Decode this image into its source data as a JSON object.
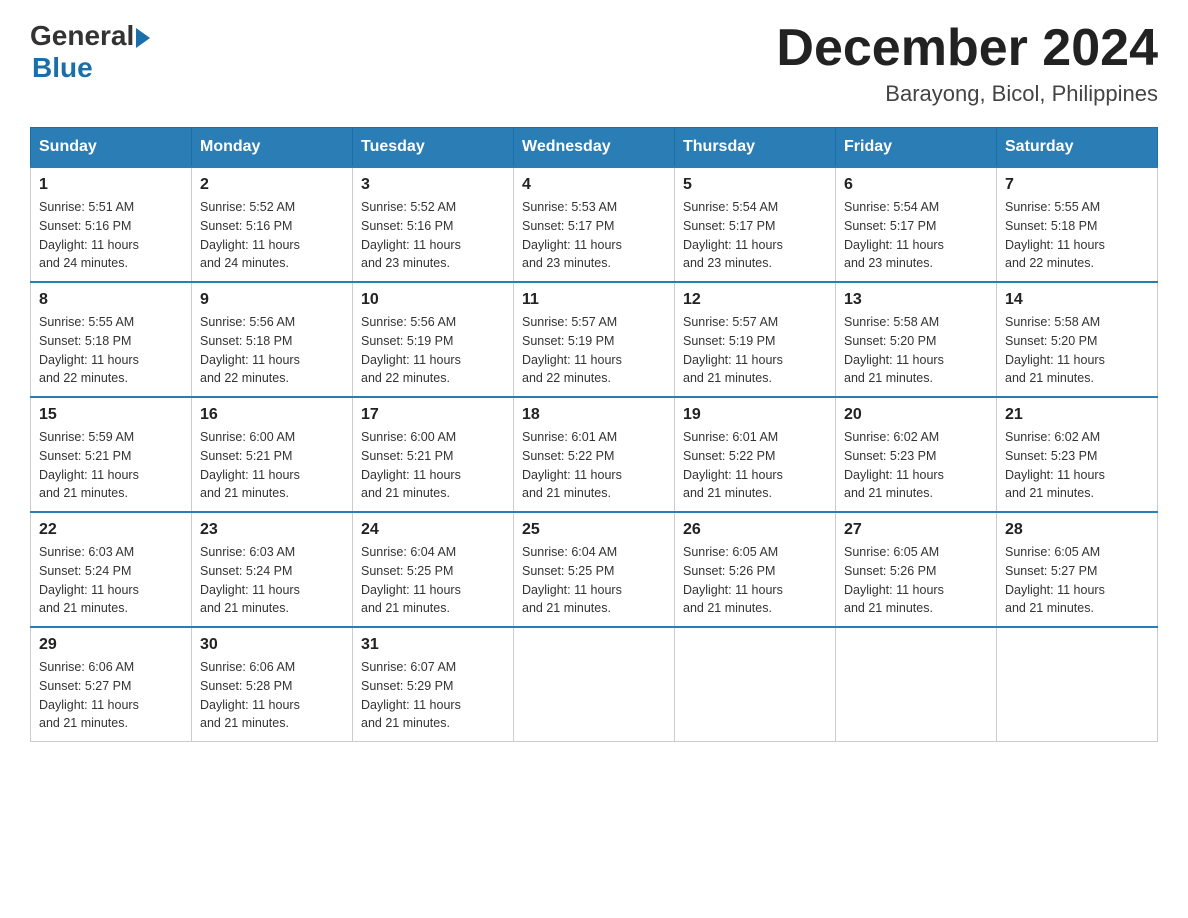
{
  "logo": {
    "general": "General",
    "blue": "Blue"
  },
  "title": {
    "month_year": "December 2024",
    "location": "Barayong, Bicol, Philippines"
  },
  "headers": [
    "Sunday",
    "Monday",
    "Tuesday",
    "Wednesday",
    "Thursday",
    "Friday",
    "Saturday"
  ],
  "weeks": [
    [
      {
        "day": "1",
        "sunrise": "5:51 AM",
        "sunset": "5:16 PM",
        "daylight": "11 hours and 24 minutes."
      },
      {
        "day": "2",
        "sunrise": "5:52 AM",
        "sunset": "5:16 PM",
        "daylight": "11 hours and 24 minutes."
      },
      {
        "day": "3",
        "sunrise": "5:52 AM",
        "sunset": "5:16 PM",
        "daylight": "11 hours and 23 minutes."
      },
      {
        "day": "4",
        "sunrise": "5:53 AM",
        "sunset": "5:17 PM",
        "daylight": "11 hours and 23 minutes."
      },
      {
        "day": "5",
        "sunrise": "5:54 AM",
        "sunset": "5:17 PM",
        "daylight": "11 hours and 23 minutes."
      },
      {
        "day": "6",
        "sunrise": "5:54 AM",
        "sunset": "5:17 PM",
        "daylight": "11 hours and 23 minutes."
      },
      {
        "day": "7",
        "sunrise": "5:55 AM",
        "sunset": "5:18 PM",
        "daylight": "11 hours and 22 minutes."
      }
    ],
    [
      {
        "day": "8",
        "sunrise": "5:55 AM",
        "sunset": "5:18 PM",
        "daylight": "11 hours and 22 minutes."
      },
      {
        "day": "9",
        "sunrise": "5:56 AM",
        "sunset": "5:18 PM",
        "daylight": "11 hours and 22 minutes."
      },
      {
        "day": "10",
        "sunrise": "5:56 AM",
        "sunset": "5:19 PM",
        "daylight": "11 hours and 22 minutes."
      },
      {
        "day": "11",
        "sunrise": "5:57 AM",
        "sunset": "5:19 PM",
        "daylight": "11 hours and 22 minutes."
      },
      {
        "day": "12",
        "sunrise": "5:57 AM",
        "sunset": "5:19 PM",
        "daylight": "11 hours and 21 minutes."
      },
      {
        "day": "13",
        "sunrise": "5:58 AM",
        "sunset": "5:20 PM",
        "daylight": "11 hours and 21 minutes."
      },
      {
        "day": "14",
        "sunrise": "5:58 AM",
        "sunset": "5:20 PM",
        "daylight": "11 hours and 21 minutes."
      }
    ],
    [
      {
        "day": "15",
        "sunrise": "5:59 AM",
        "sunset": "5:21 PM",
        "daylight": "11 hours and 21 minutes."
      },
      {
        "day": "16",
        "sunrise": "6:00 AM",
        "sunset": "5:21 PM",
        "daylight": "11 hours and 21 minutes."
      },
      {
        "day": "17",
        "sunrise": "6:00 AM",
        "sunset": "5:21 PM",
        "daylight": "11 hours and 21 minutes."
      },
      {
        "day": "18",
        "sunrise": "6:01 AM",
        "sunset": "5:22 PM",
        "daylight": "11 hours and 21 minutes."
      },
      {
        "day": "19",
        "sunrise": "6:01 AM",
        "sunset": "5:22 PM",
        "daylight": "11 hours and 21 minutes."
      },
      {
        "day": "20",
        "sunrise": "6:02 AM",
        "sunset": "5:23 PM",
        "daylight": "11 hours and 21 minutes."
      },
      {
        "day": "21",
        "sunrise": "6:02 AM",
        "sunset": "5:23 PM",
        "daylight": "11 hours and 21 minutes."
      }
    ],
    [
      {
        "day": "22",
        "sunrise": "6:03 AM",
        "sunset": "5:24 PM",
        "daylight": "11 hours and 21 minutes."
      },
      {
        "day": "23",
        "sunrise": "6:03 AM",
        "sunset": "5:24 PM",
        "daylight": "11 hours and 21 minutes."
      },
      {
        "day": "24",
        "sunrise": "6:04 AM",
        "sunset": "5:25 PM",
        "daylight": "11 hours and 21 minutes."
      },
      {
        "day": "25",
        "sunrise": "6:04 AM",
        "sunset": "5:25 PM",
        "daylight": "11 hours and 21 minutes."
      },
      {
        "day": "26",
        "sunrise": "6:05 AM",
        "sunset": "5:26 PM",
        "daylight": "11 hours and 21 minutes."
      },
      {
        "day": "27",
        "sunrise": "6:05 AM",
        "sunset": "5:26 PM",
        "daylight": "11 hours and 21 minutes."
      },
      {
        "day": "28",
        "sunrise": "6:05 AM",
        "sunset": "5:27 PM",
        "daylight": "11 hours and 21 minutes."
      }
    ],
    [
      {
        "day": "29",
        "sunrise": "6:06 AM",
        "sunset": "5:27 PM",
        "daylight": "11 hours and 21 minutes."
      },
      {
        "day": "30",
        "sunrise": "6:06 AM",
        "sunset": "5:28 PM",
        "daylight": "11 hours and 21 minutes."
      },
      {
        "day": "31",
        "sunrise": "6:07 AM",
        "sunset": "5:29 PM",
        "daylight": "11 hours and 21 minutes."
      },
      null,
      null,
      null,
      null
    ]
  ],
  "labels": {
    "sunrise": "Sunrise:",
    "sunset": "Sunset:",
    "daylight": "Daylight:"
  }
}
